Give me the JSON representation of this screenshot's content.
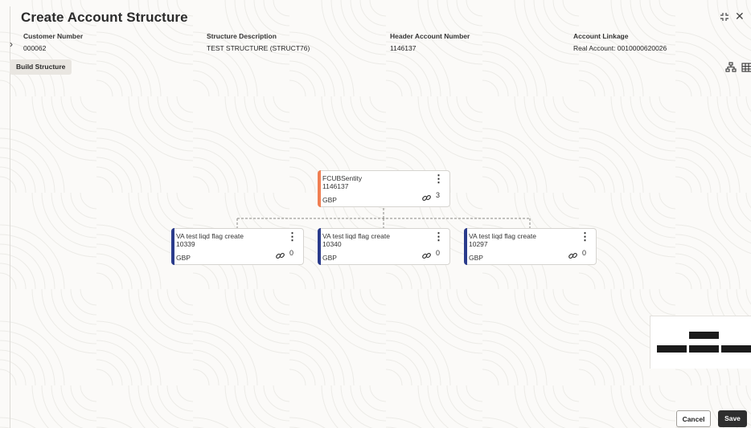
{
  "header": {
    "title": "Create Account Structure"
  },
  "window_controls": {
    "maximize_icon": "maximize-icon",
    "close_icon": "close-icon",
    "close_glyph": "✕"
  },
  "fields": [
    {
      "label": "Customer Number",
      "value": "000062"
    },
    {
      "label": "Structure Description",
      "value": "TEST STRUCTURE (STRUCT76)"
    },
    {
      "label": "Header Account Number",
      "value": "1146137"
    },
    {
      "label": "Account Linkage",
      "value": "Real Account: 0010000620026"
    }
  ],
  "toolbar": {
    "build_label": "Build Structure",
    "expand_glyph": "›"
  },
  "tree": {
    "root": {
      "name": "FCUBSentity",
      "number": "1146137",
      "currency": "GBP",
      "links": "3"
    },
    "children": [
      {
        "name": "VA test liqd flag create",
        "number": "10339",
        "currency": "GBP",
        "links": "0"
      },
      {
        "name": "VA test liqd flag create",
        "number": "10340",
        "currency": "GBP",
        "links": "0"
      },
      {
        "name": "VA test liqd flag create",
        "number": "10297",
        "currency": "GBP",
        "links": "0"
      }
    ]
  },
  "colors": {
    "root_accent": "#f07f53",
    "child_accent": "#2b3c8c"
  },
  "footer": {
    "cancel_label": "Cancel",
    "save_label": "Save"
  }
}
